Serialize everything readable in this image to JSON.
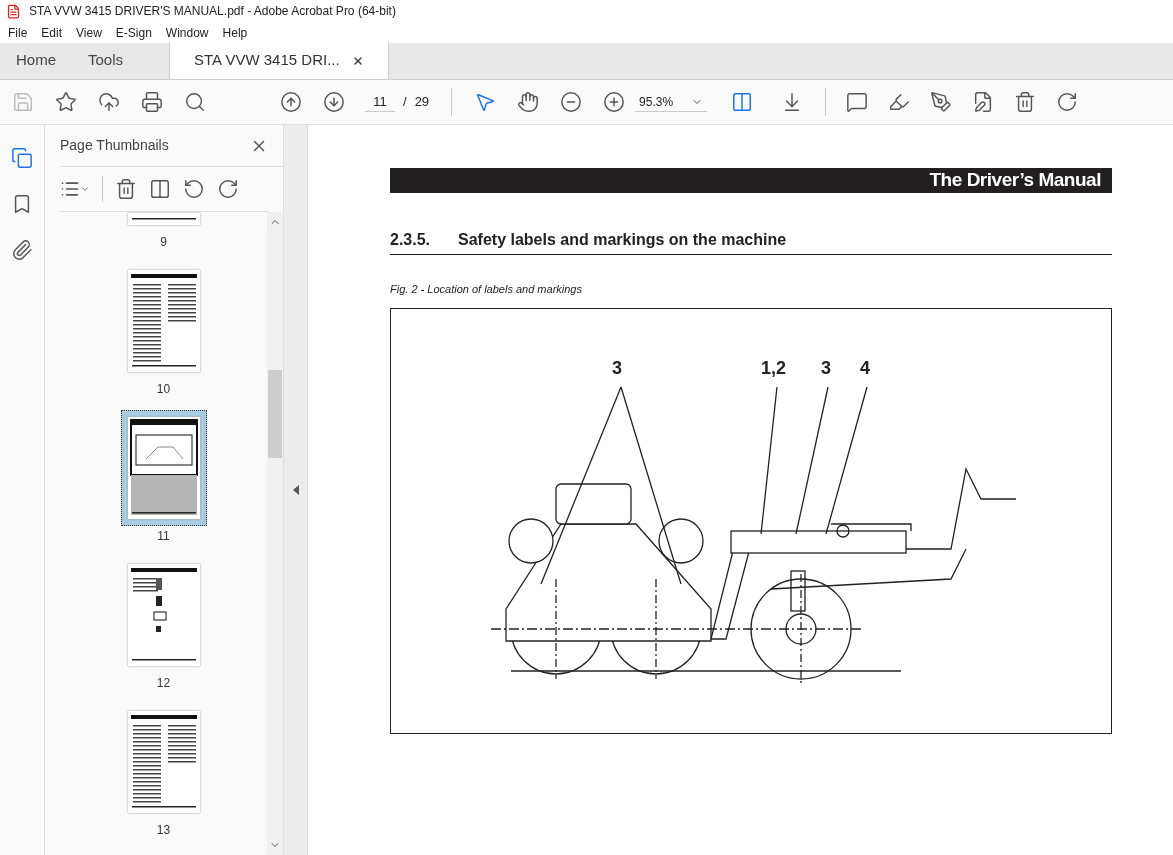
{
  "window": {
    "title": "STA VVW 3415 DRIVER'S MANUAL.pdf - Adobe Acrobat Pro (64-bit)"
  },
  "menu": [
    "File",
    "Edit",
    "View",
    "E-Sign",
    "Window",
    "Help"
  ],
  "tabs": [
    {
      "label": "Home",
      "selected": false,
      "closable": false
    },
    {
      "label": "Tools",
      "selected": false,
      "closable": false
    },
    {
      "label": "STA VVW 3415 DRI...",
      "selected": true,
      "closable": true
    }
  ],
  "toolbar": {
    "page_current": "11",
    "page_separator": "/",
    "page_total": "29",
    "zoom": "95.3%"
  },
  "sidebar": {
    "title": "Page Thumbnails",
    "thumbnails": [
      {
        "label": "9",
        "kind": "cut",
        "selected": false
      },
      {
        "label": "10",
        "kind": "text",
        "selected": false
      },
      {
        "label": "11",
        "kind": "figure",
        "selected": true
      },
      {
        "label": "12",
        "kind": "labels",
        "selected": false
      },
      {
        "label": "13",
        "kind": "text",
        "selected": false
      }
    ]
  },
  "document": {
    "header": "The Driver’s Manual",
    "section_number": "2.3.5.",
    "section_title": "Safety labels and markings on the machine",
    "caption": "Fig. 2 - Location of labels and markings",
    "callouts": [
      "3",
      "1,2",
      "3",
      "4"
    ]
  }
}
